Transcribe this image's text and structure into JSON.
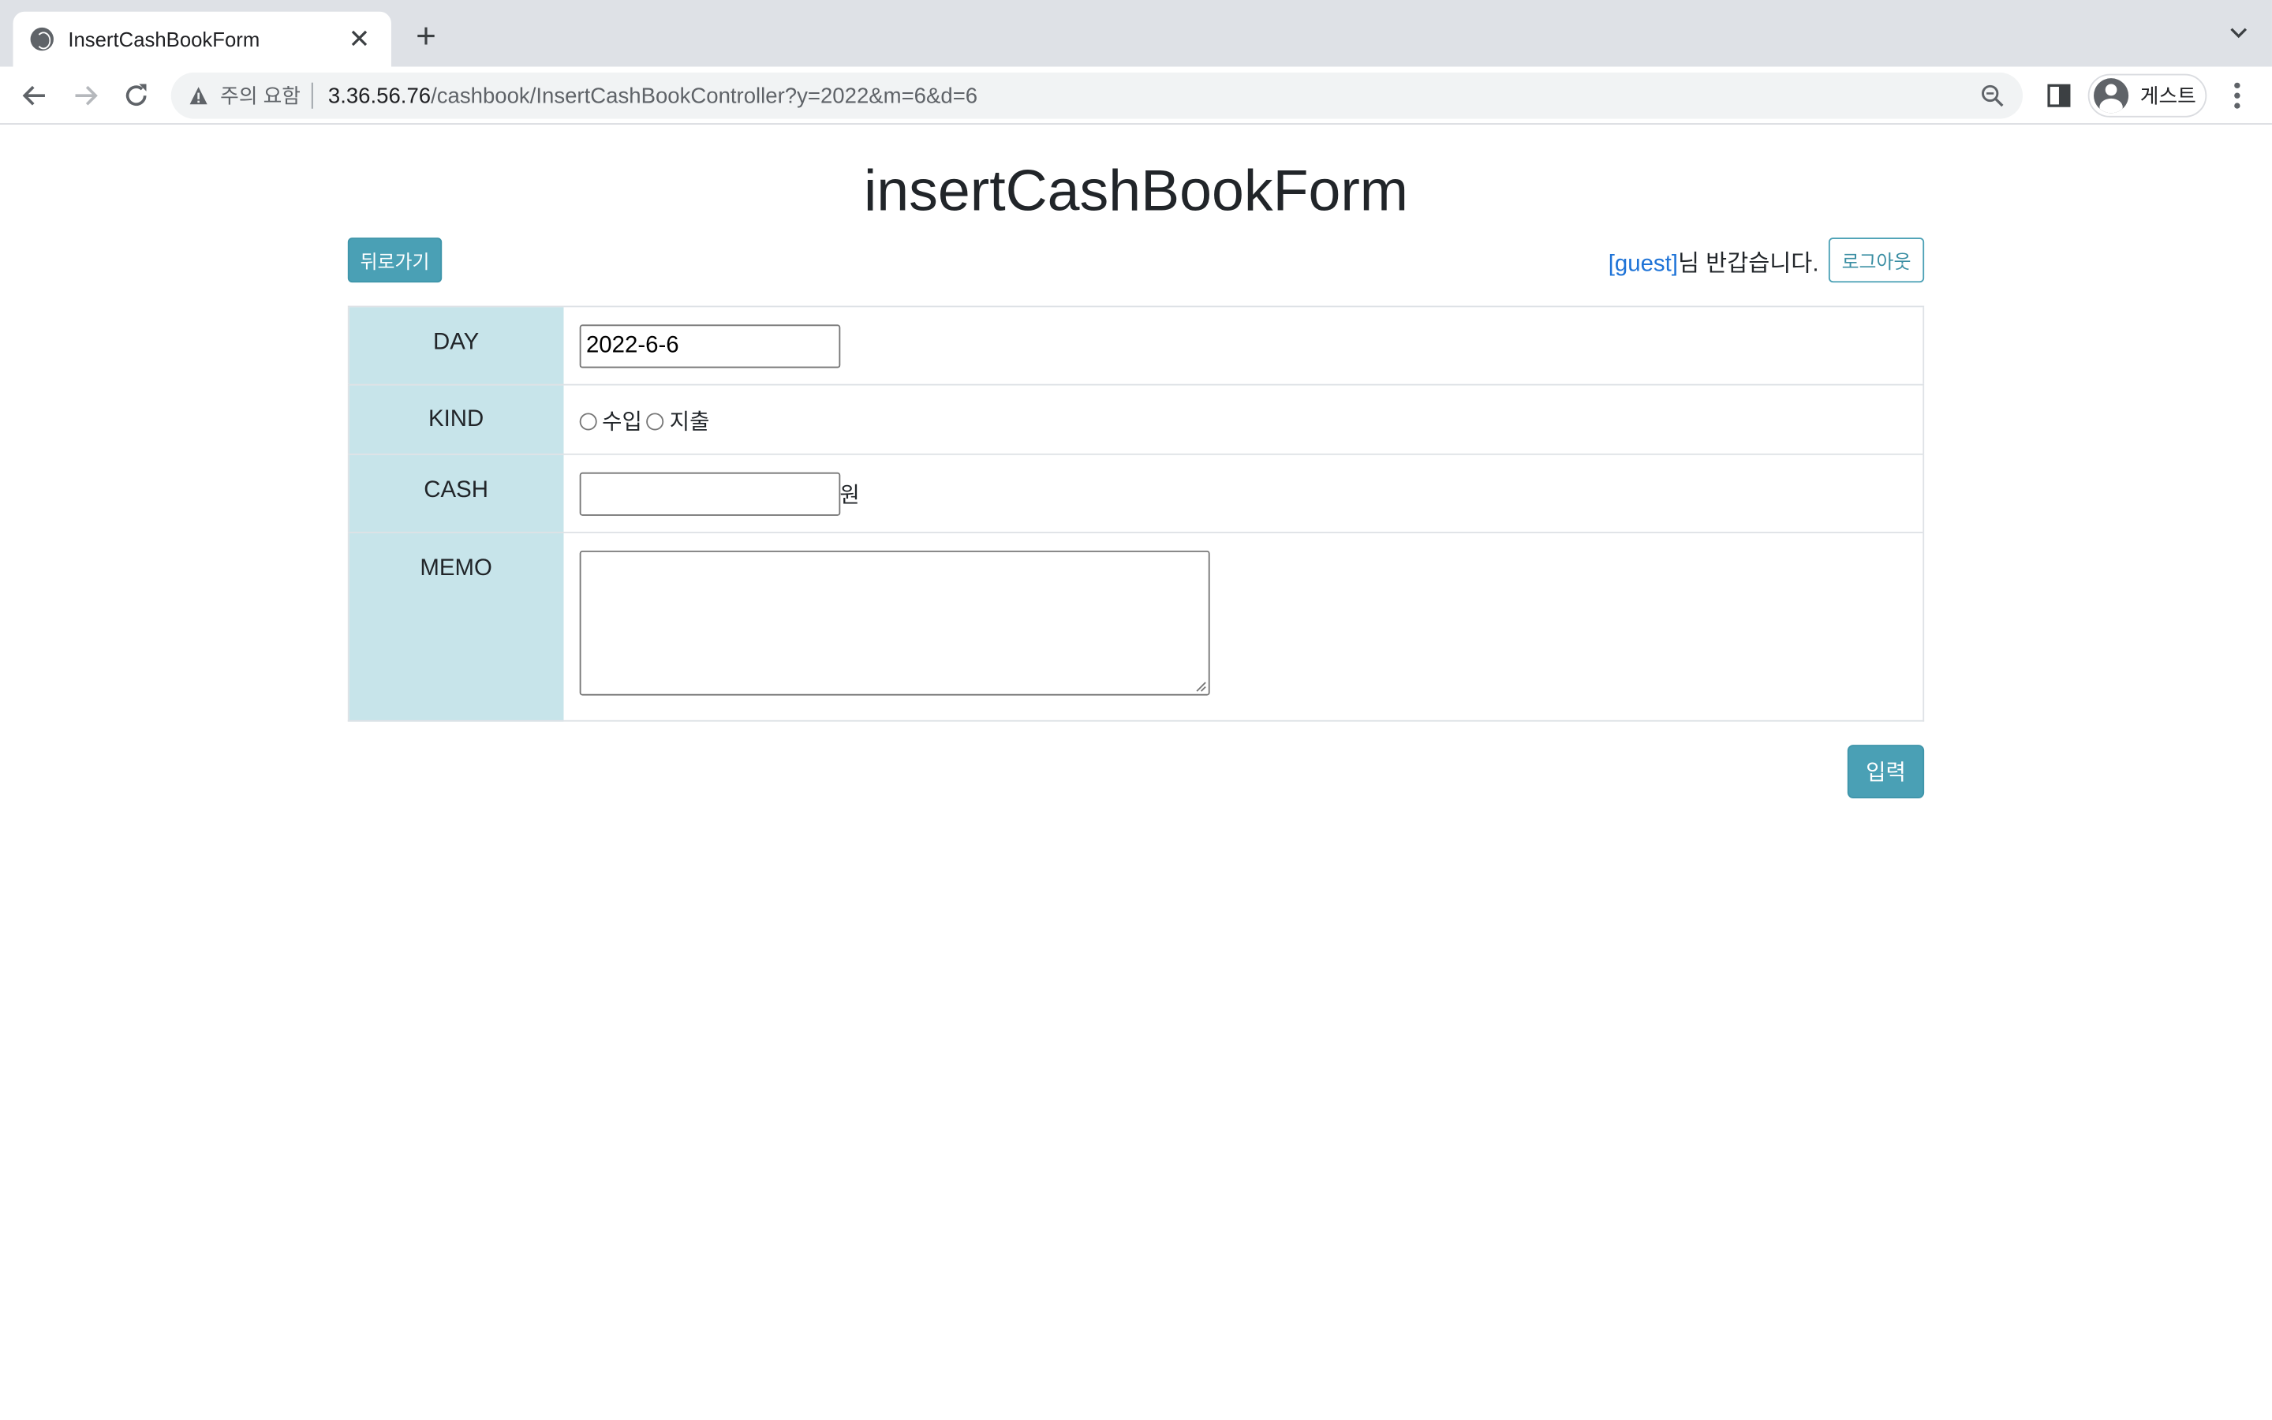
{
  "browser": {
    "tab_title": "InsertCashBookForm",
    "tab_close": "✕",
    "new_tab": "+",
    "security_warning": "주의 요함",
    "url_host": "3.36.56.76",
    "url_path": "/cashbook/InsertCashBookController?y=2022&m=6&d=6",
    "profile_label": "게스트"
  },
  "page": {
    "title": "insertCashBookForm",
    "back_button": "뒤로가기",
    "greeting_user": "[guest]",
    "greeting_suffix": "님 반갑습니다.",
    "logout_button": "로그아웃"
  },
  "form": {
    "day_label": "DAY",
    "day_value": "2022-6-6",
    "kind_label": "KIND",
    "kind_options": [
      "수입",
      "지출"
    ],
    "cash_label": "CASH",
    "cash_value": "",
    "cash_unit": "원",
    "memo_label": "MEMO",
    "memo_value": "",
    "submit_button": "입력"
  },
  "colors": {
    "accent": "#4aa0b5",
    "label_bg": "#c7e4ea",
    "link": "#1e73d7"
  }
}
